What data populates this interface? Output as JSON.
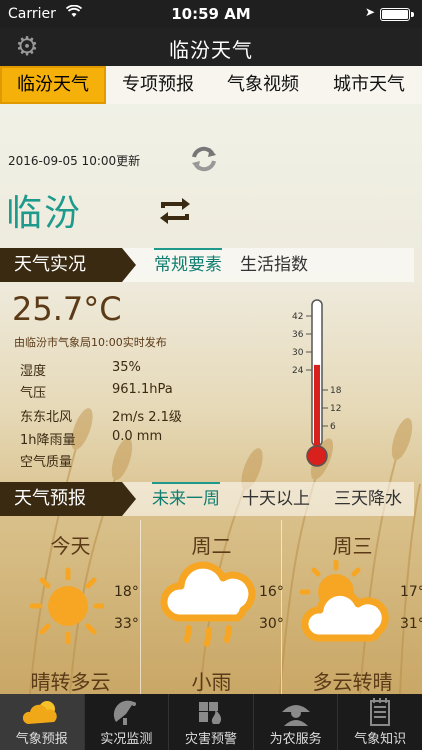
{
  "status_bar": {
    "carrier": "Carrier",
    "time": "10:59 AM"
  },
  "nav": {
    "title": "临汾天气",
    "settings_icon": "gear-icon"
  },
  "tabs": [
    {
      "label": "临汾天气",
      "active": true
    },
    {
      "label": "专项预报",
      "active": false
    },
    {
      "label": "气象视频",
      "active": false
    },
    {
      "label": "城市天气",
      "active": false
    }
  ],
  "update_time": "2016-09-05 10:00更新",
  "city": "临汾",
  "current": {
    "section_label": "天气实况",
    "subtabs": [
      "常规要素",
      "生活指数"
    ],
    "temperature": "25.7°C",
    "source": "由临汾市气象局10:00实时发布",
    "stats": [
      {
        "label": "湿度",
        "value": "35%"
      },
      {
        "label": "气压",
        "value": "961.1hPa"
      },
      {
        "label": "东东北风",
        "value": "2m/s 2.1级"
      },
      {
        "label": "1h降雨量",
        "value": "0.0 mm"
      },
      {
        "label": "空气质量",
        "value": ""
      }
    ],
    "thermometer": {
      "left_ticks": [
        "42",
        "36",
        "30",
        "24"
      ],
      "right_ticks": [
        "18",
        "12",
        "6"
      ],
      "level_celsius": 25.7
    }
  },
  "forecast": {
    "section_label": "天气预报",
    "subtabs": [
      "未来一周",
      "十天以上",
      "三天降水"
    ],
    "days": [
      {
        "name": "今天",
        "high": "18°",
        "low": "33°",
        "desc": "晴转多云",
        "icon": "sun-icon"
      },
      {
        "name": "周二",
        "high": "16°",
        "low": "30°",
        "desc": "小雨",
        "icon": "rain-cloud-icon"
      },
      {
        "name": "周三",
        "high": "17°",
        "low": "31°",
        "desc": "多云转晴",
        "icon": "sun-cloud-icon"
      }
    ]
  },
  "bottom_tabs": [
    {
      "label": "气象预报",
      "icon": "weather-icon",
      "active": true
    },
    {
      "label": "实况监测",
      "icon": "radar-icon",
      "active": false
    },
    {
      "label": "灾害预警",
      "icon": "warning-icon",
      "active": false
    },
    {
      "label": "为农服务",
      "icon": "farmer-icon",
      "active": false
    },
    {
      "label": "气象知识",
      "icon": "notebook-icon",
      "active": false
    }
  ]
}
